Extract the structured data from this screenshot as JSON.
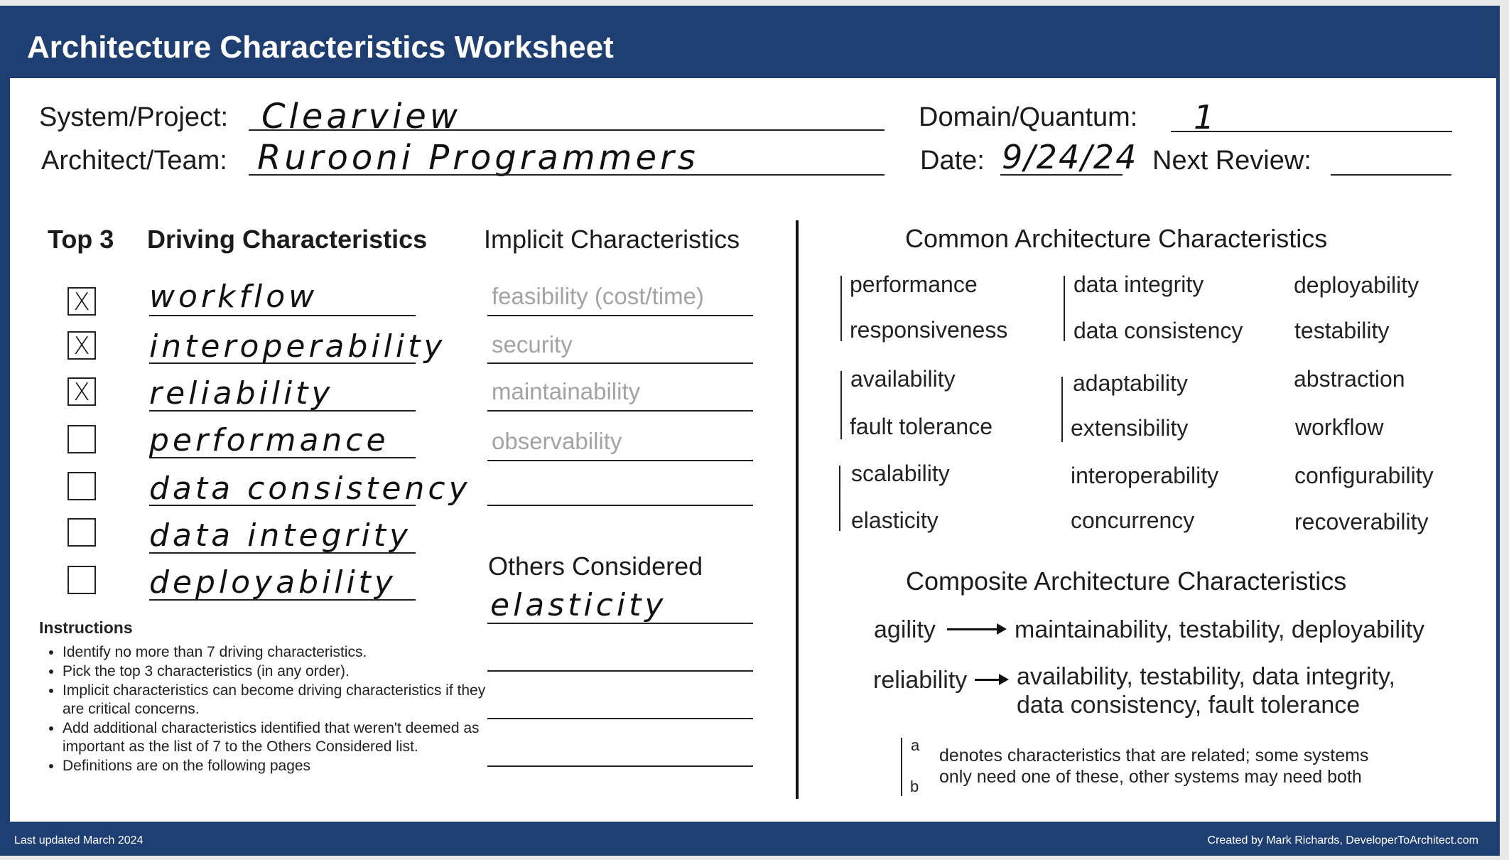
{
  "header": {
    "title": "Architecture Characteristics Worksheet"
  },
  "form": {
    "system_label": "System/Project:",
    "system_value": "Clearview",
    "team_label": "Architect/Team:",
    "team_value": "Rurooni Programmers",
    "domain_label": "Domain/Quantum:",
    "domain_value": "1",
    "date_label": "Date:",
    "date_value": "9/24/24",
    "review_label": "Next Review:",
    "review_value": ""
  },
  "driving": {
    "top3_heading": "Top 3",
    "heading": "Driving Characteristics",
    "items": [
      {
        "checked": true,
        "mark": "X",
        "value": "workflow"
      },
      {
        "checked": true,
        "mark": "X",
        "value": "interoperability"
      },
      {
        "checked": true,
        "mark": "X",
        "value": "reliability"
      },
      {
        "checked": false,
        "mark": "",
        "value": "performance"
      },
      {
        "checked": false,
        "mark": "",
        "value": "data consistency"
      },
      {
        "checked": false,
        "mark": "",
        "value": "data integrity"
      },
      {
        "checked": false,
        "mark": "",
        "value": "deployability"
      }
    ]
  },
  "implicit": {
    "heading": "Implicit Characteristics",
    "items": [
      "feasibility (cost/time)",
      "security",
      "maintainability",
      "observability",
      ""
    ]
  },
  "others": {
    "heading": "Others Considered",
    "items": [
      "elasticity",
      "",
      "",
      ""
    ]
  },
  "instructions": {
    "title": "Instructions",
    "items": [
      "Identify no more than 7 driving characteristics.",
      "Pick the top 3 characteristics (in any order).",
      "Implicit characteristics can become driving characteristics if they are critical concerns.",
      "Add additional characteristics identified that weren't deemed as important as the list of 7 to the Others Considered list.",
      "Definitions are on the following pages"
    ]
  },
  "common": {
    "heading": "Common Architecture Characteristics",
    "col1": [
      "performance",
      "responsiveness",
      "availability",
      "fault tolerance",
      "scalability",
      "elasticity"
    ],
    "col2": [
      "data integrity",
      "data consistency",
      "adaptability",
      "extensibility",
      "interoperability",
      "concurrency"
    ],
    "col3": [
      "deployability",
      "testability",
      "abstraction",
      "workflow",
      "configurability",
      "recoverability"
    ]
  },
  "composite": {
    "heading": "Composite Architecture Characteristics",
    "agility_label": "agility",
    "agility_value": "maintainability, testability, deployability",
    "reliability_label": "reliability",
    "reliability_line1": "availability, testability, data integrity,",
    "reliability_line2": "data consistency, fault tolerance"
  },
  "legend": {
    "a": "a",
    "b": "b",
    "line1": "denotes characteristics that are related; some systems",
    "line2": "only need one of these, other systems may need both"
  },
  "footer": {
    "left": "Last updated March 2024",
    "right": "Created by Mark Richards, DeveloperToArchitect.com"
  },
  "colors": {
    "banner": "#1f3f73",
    "implicit_text": "#a3a3a3"
  }
}
